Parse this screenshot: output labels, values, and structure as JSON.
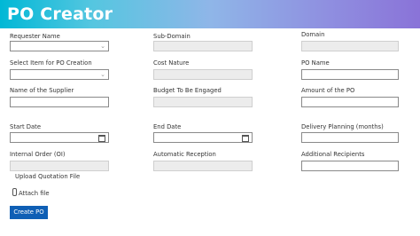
{
  "header": {
    "title": "PO Creator"
  },
  "form": {
    "requester_name": {
      "label": "Requester Name",
      "value": ""
    },
    "sub_domain": {
      "label": "Sub-Domain",
      "value": ""
    },
    "domain": {
      "label": "Domain",
      "value": ""
    },
    "select_item": {
      "label": "Select Item for PO Creation",
      "value": ""
    },
    "cost_nature": {
      "label": "Cost Nature",
      "value": ""
    },
    "po_name": {
      "label": "PO Name",
      "value": ""
    },
    "supplier_name": {
      "label": "Name of the Supplier",
      "value": ""
    },
    "budget_engaged": {
      "label": "Budget To Be Engaged",
      "value": ""
    },
    "po_amount": {
      "label": "Amount of the PO",
      "value": ""
    },
    "start_date": {
      "label": "Start Date",
      "value": ""
    },
    "end_date": {
      "label": "End Date",
      "value": ""
    },
    "delivery_planning": {
      "label": "Delivery Planning (months)",
      "value": ""
    },
    "internal_order": {
      "label": "Internal Order (OI)",
      "value": ""
    },
    "automatic_reception": {
      "label": "Automatic Reception",
      "value": ""
    },
    "additional_recipients": {
      "label": "Additional Recipients",
      "value": ""
    },
    "upload_quotation": {
      "label": "Upload Quotation File",
      "attach_label": "Attach file"
    }
  },
  "actions": {
    "create_label": "Create PO"
  },
  "colors": {
    "header_gradient_start": "#00b8d6",
    "header_gradient_end": "#8a73d8",
    "primary_button": "#0f5fb5"
  },
  "icons": {
    "dropdown": "chevron-down-icon",
    "date": "calendar-icon",
    "attach": "paperclip-icon"
  }
}
